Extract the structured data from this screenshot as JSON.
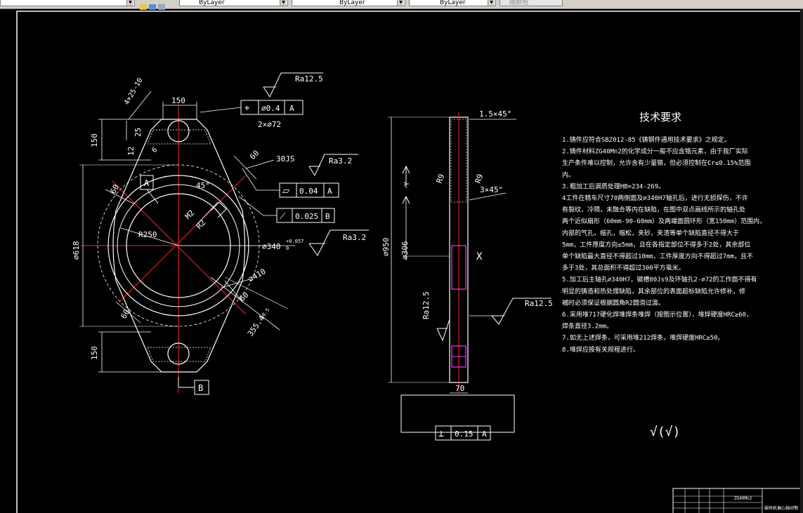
{
  "toolbar": {
    "layer_value": "ByLayer",
    "linetype_value": "ByLayer",
    "lineweight_value": "ByLayer",
    "plotstyle_value": "随颜色"
  },
  "drawing": {
    "front_view": {
      "dim_4x25_10": "4×25-10",
      "dim_150_top": "150",
      "gtol_position_symbol": "⌖",
      "gtol_position_value": "⌀0.4",
      "gtol_position_datum": "A",
      "dim_2x_phi72": "2×⌀72",
      "rough_top": "Ra12.5",
      "dim_150_left_top": "150",
      "dim_25": "25",
      "dim_12": "12",
      "dim_6": "6",
      "datum_a_label": "A",
      "dim_60_left": "60",
      "dim_45deg": "45°",
      "dim_60_diag": "60",
      "dim_30js": "30JS",
      "rough_ra32_upper": "Ra3.2",
      "gtol_flat_symbol": "⏥",
      "gtol_flat_value": "0.04",
      "gtol_flat_datum": "A",
      "gtol_perp_symbol": "⟋",
      "gtol_perp_value": "0.025",
      "gtol_perp_datum": "B",
      "dim_r2": "R2",
      "dim_m2": "M2",
      "dim_r250": "R250",
      "dim_phi340": "⌀340",
      "dim_phi340_tol": "+0.057",
      "dim_phi340_tol2": "0",
      "rough_ra32_lower": "Ra3.2",
      "dim_phi618": "⌀618",
      "dim_phi410": "⌀410",
      "dim_60_bottom_left": "60",
      "dim_60_bottom_right": "60",
      "dim_355": "355.4",
      "dim_355_tol": "+0.5",
      "dim_150_left_bottom": "150",
      "datum_b_label": "B"
    },
    "side_view": {
      "dim_chamfer_top": "1.5×45°",
      "dim_r9_left": "R9",
      "dim_r9_right": "R9",
      "dim_chamfer_mid": "3×45°",
      "dim_phi950": "⌀950",
      "dim_y": "Y",
      "dim_phi306": "⌀306",
      "mark_x": "X",
      "rough_ra125_left": "Ra12.5",
      "rough_ra125_right": "Ra12.5",
      "dim_70": "70",
      "gtol_perp2_symbol": "⊥",
      "gtol_perp2_value": "0.15",
      "gtol_perp2_datum": "A"
    },
    "tech_req": {
      "title": "技术要求",
      "lines": [
        "1.铸件应符合SBZ012-85《铸钢件通用技术要求》之规定。",
        "2.铸件材料ZG40Mn2的化学成分一般不应含铬元素，由于我厂实际",
        "生产条件难以控制，允许含有少量铬，但必须控制在Cr≤0.15%范围",
        "内。",
        "3.粗加工后调质处理HB=234-269。",
        "4工件在精车尺寸70两侧面及⌀340H7轴孔后，进行无损探伤，不许",
        "有裂纹，冷隔，未融合等内在缺陷，在图中双点画线所示的轴孔处",
        "两个近似扇形（60mm-90-60mm）及两端面圆环形（宽150mm）范围内，",
        "内部的气孔，缩孔，缩松，夹砂，夹渣等单个缺陷直径不得大于",
        "5mm，工件厚度方向≤5mm，且在各指定部位不得多于2处，其余部位",
        "单个缺陷最大直径不得超过10mm，工件厚度方向不得超过7mm，且不",
        "多于3处，其总面积不得超过300平方毫米。",
        "5.加工后主轴孔⌀340H7，键槽80Js9及环轴孔2-⌀72的工作面不得有",
        "明显的铸造和热处理缺陷，其余部位的表面超标缺陷允许修补，修",
        "補时必须保证根据圆角R2圆滑过渡。",
        "6.采用堆717硬化焊堆焊条堆焊（按图示位置），堆焊硬度HRC≥60，",
        "焊条直径3.2mm。",
        "7.如无上述焊条，可采用堆212焊条，堆焊硬度HRC≥50。",
        "8.堆焊应按有关规程进行。"
      ],
      "rough_general": "√(√)"
    },
    "title_block": {
      "material": "ZG40Mn2",
      "name": "破碎机偏心轴动颚"
    }
  }
}
